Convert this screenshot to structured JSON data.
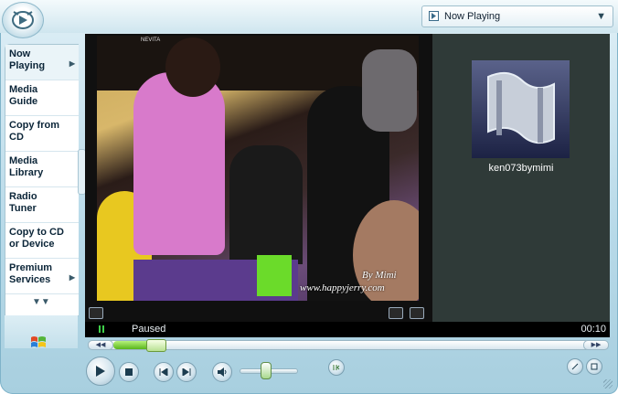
{
  "player": {
    "now_playing_label": "Now Playing",
    "status": "Paused",
    "elapsed_time": "00:10",
    "media_title": "ken073bymimi",
    "progress_fraction": 0.12,
    "volume_fraction": 0.45
  },
  "sidebar": {
    "items": [
      {
        "label_line1": "Now",
        "label_line2": "Playing",
        "has_chevron": true,
        "active": true
      },
      {
        "label_line1": "Media",
        "label_line2": "Guide",
        "has_chevron": false,
        "active": false
      },
      {
        "label_line1": "Copy from",
        "label_line2": "CD",
        "has_chevron": false,
        "active": false
      },
      {
        "label_line1": "Media",
        "label_line2": "Library",
        "has_chevron": false,
        "active": false
      },
      {
        "label_line1": "Radio",
        "label_line2": "Tuner",
        "has_chevron": false,
        "active": false
      },
      {
        "label_line1": "Copy to CD",
        "label_line2": "or Device",
        "has_chevron": false,
        "active": false
      },
      {
        "label_line1": "Premium",
        "label_line2": "Services",
        "has_chevron": true,
        "active": false
      }
    ]
  },
  "video": {
    "watermark_line1": "By Mimi",
    "watermark_line2": "www.happyjerry.com",
    "channel_bug": "NEVITA"
  },
  "icons": {
    "now_playing": "now-playing-icon",
    "dropdown": "chevron-down-icon",
    "play": "play-icon",
    "stop": "stop-icon",
    "previous": "previous-track-icon",
    "next": "next-track-icon",
    "mute": "speaker-icon",
    "windows": "windows-flag-icon"
  },
  "colors": {
    "frame": "#b7d9e8",
    "video_bg": "#101010",
    "right_panel": "#2f3a38",
    "progress": "#58b51a",
    "pause_indicator": "#3fd04a"
  }
}
